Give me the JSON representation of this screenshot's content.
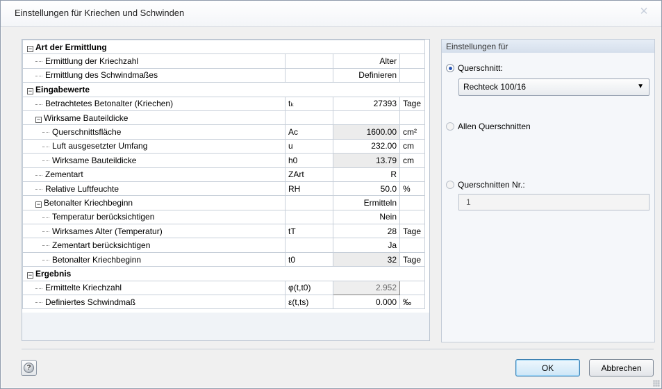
{
  "window": {
    "title": "Einstellungen für Kriechen und Schwinden",
    "close_symbol": "✕"
  },
  "table": {
    "rows": [
      {
        "kind": "section",
        "desc": "Art der Ermittlung",
        "sym": "",
        "val": "",
        "unit": ""
      },
      {
        "kind": "item",
        "level": 1,
        "desc": "Ermittlung der Kriechzahl",
        "sym": "",
        "val": "Alter",
        "unit": ""
      },
      {
        "kind": "item",
        "level": 1,
        "desc": "Ermittlung des Schwindmaßes",
        "sym": "",
        "val": "Definieren",
        "unit": ""
      },
      {
        "kind": "section",
        "desc": "Eingabewerte",
        "sym": "",
        "val": "",
        "unit": ""
      },
      {
        "kind": "item",
        "level": 1,
        "desc": "Betrachtetes Betonalter (Kriechen)",
        "sym": "tₖ",
        "val": "27393",
        "unit": "Tage"
      },
      {
        "kind": "group",
        "level": 1,
        "desc": "Wirksame Bauteildicke",
        "sym": "",
        "val": "",
        "unit": ""
      },
      {
        "kind": "item",
        "level": 2,
        "desc": "Querschnittsfläche",
        "sym": "Ac",
        "val": "1600.00",
        "unit": "cm²",
        "grey": true
      },
      {
        "kind": "item",
        "level": 2,
        "desc": "Luft ausgesetzter Umfang",
        "sym": "u",
        "val": "232.00",
        "unit": "cm"
      },
      {
        "kind": "item",
        "level": 2,
        "desc": "Wirksame Bauteildicke",
        "sym": "h0",
        "val": "13.79",
        "unit": "cm",
        "grey": true
      },
      {
        "kind": "item",
        "level": 1,
        "desc": "Zementart",
        "sym": "ZArt",
        "val": "R",
        "unit": ""
      },
      {
        "kind": "item",
        "level": 1,
        "desc": "Relative Luftfeuchte",
        "sym": "RH",
        "val": "50.0",
        "unit": "%"
      },
      {
        "kind": "group",
        "level": 1,
        "desc": "Betonalter Kriechbeginn",
        "sym": "",
        "val": "Ermitteln",
        "unit": ""
      },
      {
        "kind": "item",
        "level": 2,
        "desc": "Temperatur berücksichtigen",
        "sym": "",
        "val": "Nein",
        "unit": ""
      },
      {
        "kind": "item",
        "level": 2,
        "desc": "Wirksames Alter (Temperatur)",
        "sym": "tT",
        "val": "28",
        "unit": "Tage"
      },
      {
        "kind": "item",
        "level": 2,
        "desc": "Zementart berücksichtigen",
        "sym": "",
        "val": "Ja",
        "unit": ""
      },
      {
        "kind": "item",
        "level": 2,
        "desc": "Betonalter Kriechbeginn",
        "sym": "t0",
        "val": "32",
        "unit": "Tage",
        "grey": true
      },
      {
        "kind": "section",
        "desc": "Ergebnis",
        "sym": "",
        "val": "",
        "unit": ""
      },
      {
        "kind": "item",
        "level": 1,
        "desc": "Ermittelte Kriechzahl",
        "sym": "φ(t,t0)",
        "val": "2.952",
        "unit": "",
        "selected": true
      },
      {
        "kind": "item",
        "level": 1,
        "desc": "Definiertes Schwindmaß",
        "sym": "ε(t,ts)",
        "val": "0.000",
        "unit": "‰"
      }
    ]
  },
  "settings": {
    "header": "Einstellungen für",
    "option_cross_section": "Querschnitt:",
    "selected_cross_section": "Rechteck 100/16",
    "option_all": "Allen Querschnitten",
    "option_numbers": "Querschnitten Nr.:",
    "numbers_value": "1"
  },
  "buttons": {
    "ok": "OK",
    "cancel": "Abbrechen",
    "help_symbol": "?"
  }
}
